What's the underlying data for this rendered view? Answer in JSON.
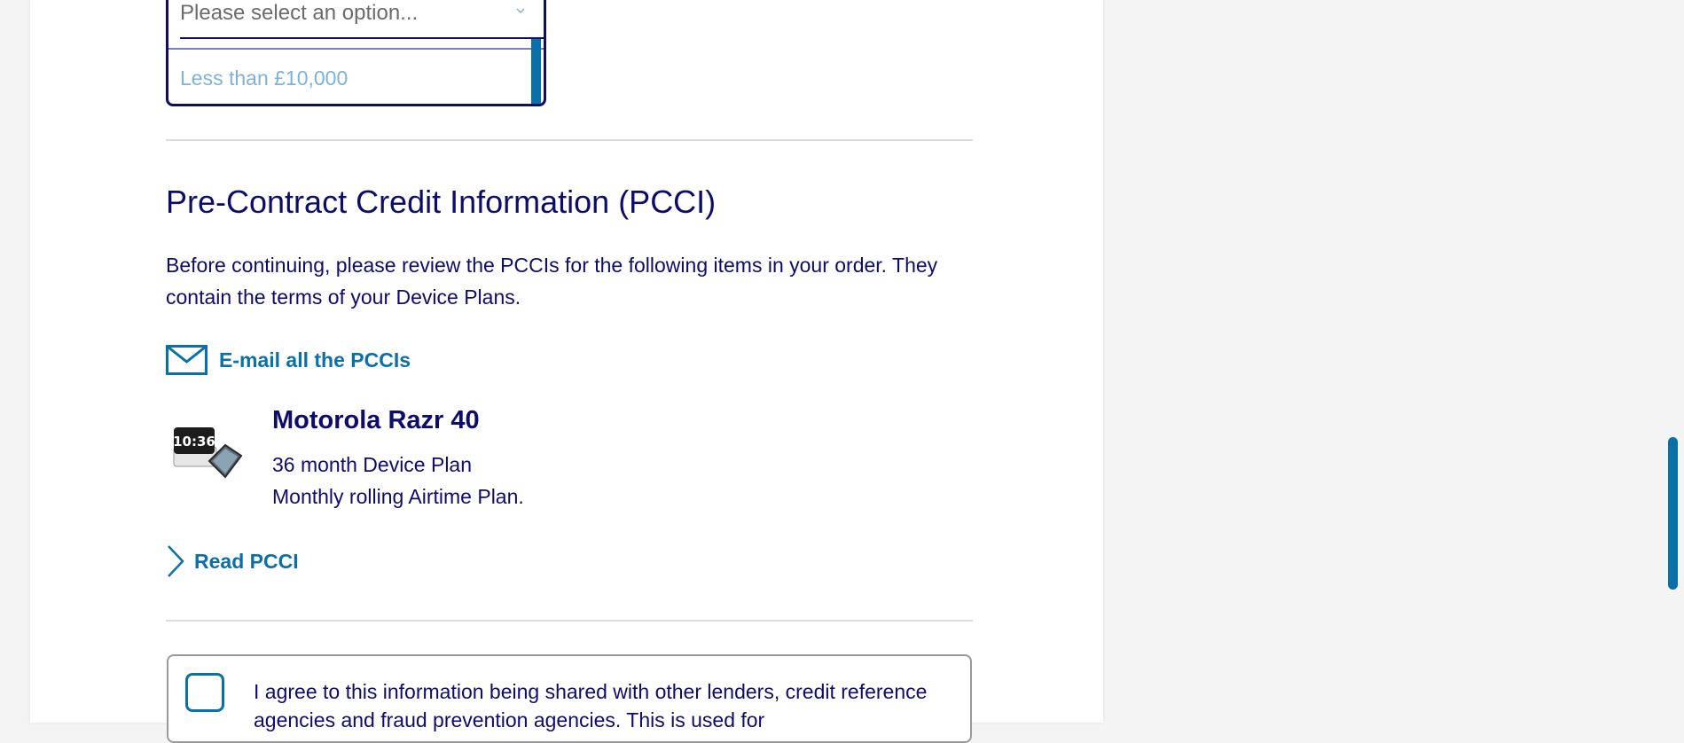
{
  "income_dropdown": {
    "placeholder": "Please select an option...",
    "visible_option": "Less than £10,000"
  },
  "pcci": {
    "heading": "Pre-Contract Credit Information (PCCI)",
    "intro": "Before continuing, please review the PCCIs for the following items in your order. They contain the terms of your Device Plans.",
    "email_link": "E-mail all the PCCIs"
  },
  "product": {
    "name": "Motorola Razr 40",
    "plan_lines": [
      "36 month Device Plan",
      "Monthly rolling Airtime Plan."
    ],
    "image_clock_text": "10:36",
    "read_link": "Read PCCI"
  },
  "consent": {
    "text": "I agree to this information being shared with other lenders, credit reference agencies and fraud prevention agencies. This is used for"
  },
  "colors": {
    "navy": "#0d0c6b",
    "link_blue": "#0b6fa8",
    "page_bg": "#f4f4f4"
  }
}
